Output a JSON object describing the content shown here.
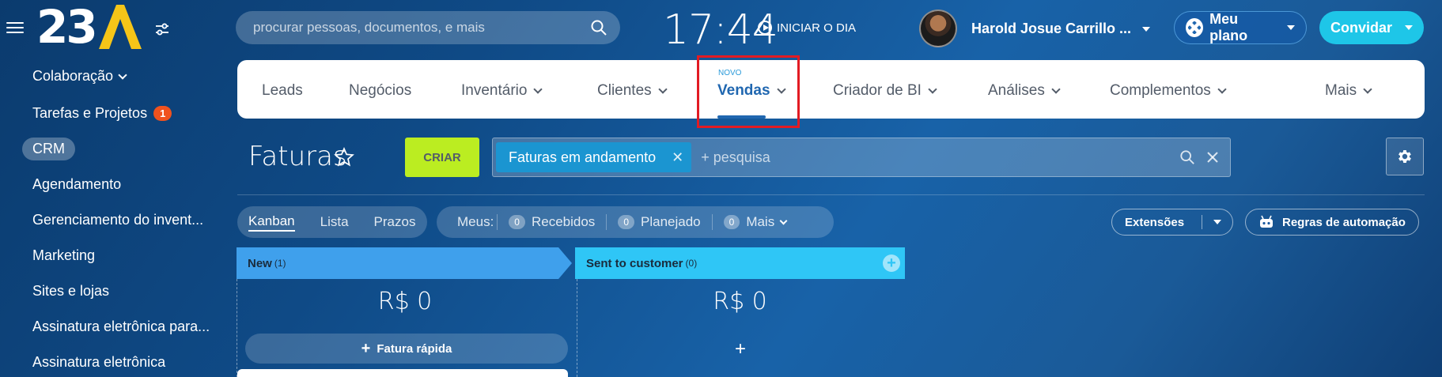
{
  "header": {
    "logo_text": "23",
    "search_placeholder": "procurar pessoas, documentos, e mais",
    "clock": "17:44",
    "start_day": "INICIAR O DIA",
    "user_name": "Harold Josue Carrillo ...",
    "plan_label": "Meu plano",
    "invite_label": "Convidar"
  },
  "sidebar": {
    "items": [
      {
        "label": "Colaboração"
      },
      {
        "label": "Tarefas e Projetos",
        "badge": "1"
      },
      {
        "label": "CRM"
      },
      {
        "label": "Agendamento"
      },
      {
        "label": "Gerenciamento do invent..."
      },
      {
        "label": "Marketing"
      },
      {
        "label": "Sites e lojas"
      },
      {
        "label": "Assinatura eletrônica para..."
      },
      {
        "label": "Assinatura eletrônica"
      }
    ]
  },
  "nav": {
    "new_tag": "NOVO",
    "items": [
      {
        "label": "Leads"
      },
      {
        "label": "Negócios"
      },
      {
        "label": "Inventário"
      },
      {
        "label": "Clientes"
      },
      {
        "label": "Vendas"
      },
      {
        "label": "Criador de BI"
      },
      {
        "label": "Análises"
      },
      {
        "label": "Complementos"
      },
      {
        "label": "Mais"
      }
    ]
  },
  "toolbar": {
    "title": "Faturas",
    "create_label": "CRIAR",
    "filter_tag": "Faturas em andamento",
    "filter_placeholder": "+ pesquisa"
  },
  "views": {
    "kanban": "Kanban",
    "list": "Lista",
    "deadlines": "Prazos"
  },
  "counters": {
    "label": "Meus:",
    "received": {
      "count": "0",
      "label": "Recebidos"
    },
    "planned": {
      "count": "0",
      "label": "Planejado"
    },
    "more": {
      "count": "0",
      "label": "Mais"
    }
  },
  "actions": {
    "extensions": "Extensões",
    "automation": "Regras de automação"
  },
  "kanban": {
    "columns": [
      {
        "title": "New",
        "count": "(1)",
        "sum": "R$ 0",
        "quick_add": "Fatura rápida"
      },
      {
        "title": "Sent to customer",
        "count": "(0)",
        "sum": "R$ 0",
        "plus": "+"
      }
    ]
  },
  "colors": {
    "accent_blue": "#2067b0",
    "create_green": "#bbed21",
    "invite_cyan": "#1ec6e8",
    "badge_red": "#f0521e",
    "highlight_red": "#e21b23",
    "col_new": "#3fa0ec",
    "col_sent": "#2fc6f6"
  }
}
